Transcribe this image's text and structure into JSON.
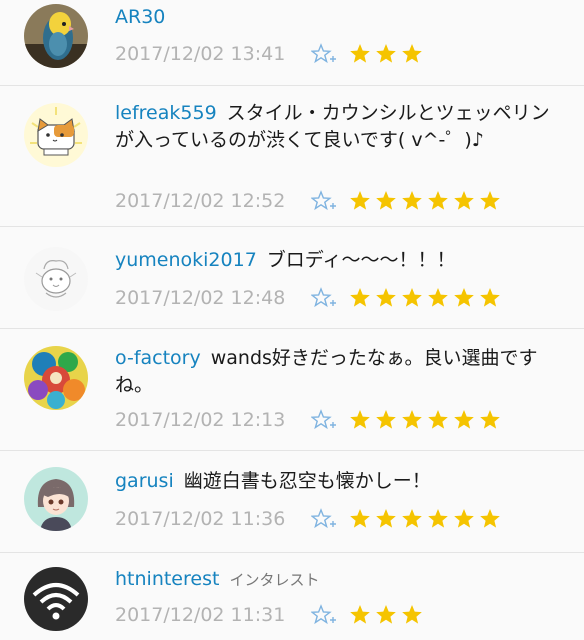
{
  "comments": [
    {
      "username": "AR30",
      "text": "",
      "timestamp": "2017/12/02 13:41",
      "stars": 3,
      "avatar_icon": "parakeet-avatar"
    },
    {
      "username": "lefreak559",
      "text": "スタイル・カウンシルとツェッペリンが入っているのが渋くて良いです( v^-゜)♪",
      "timestamp": "2017/12/02 12:52",
      "stars": 6,
      "avatar_icon": "cat-avatar"
    },
    {
      "username": "yumenoki2017",
      "text": "ブロディ〜〜〜！！！",
      "timestamp": "2017/12/02 12:48",
      "stars": 6,
      "avatar_icon": "sketch-animal-avatar"
    },
    {
      "username": "o-factory",
      "text": "wands好きだったなぁ。良い選曲ですね。",
      "timestamp": "2017/12/02 12:13",
      "stars": 6,
      "avatar_icon": "colorful-illustration-avatar"
    },
    {
      "username": "garusi",
      "text": "幽遊白書も忍空も懐かしー！",
      "timestamp": "2017/12/02 11:36",
      "stars": 6,
      "avatar_icon": "anime-girl-avatar"
    },
    {
      "username": "htninterest",
      "text": "インタレスト",
      "timestamp": "2017/12/02 11:31",
      "stars": 3,
      "avatar_icon": "wifi-logo-avatar"
    }
  ],
  "colors": {
    "username": "#1683bf",
    "timestamp": "#b3b3b3",
    "star": "#f5c400",
    "add_star": "#7fb3e0"
  }
}
